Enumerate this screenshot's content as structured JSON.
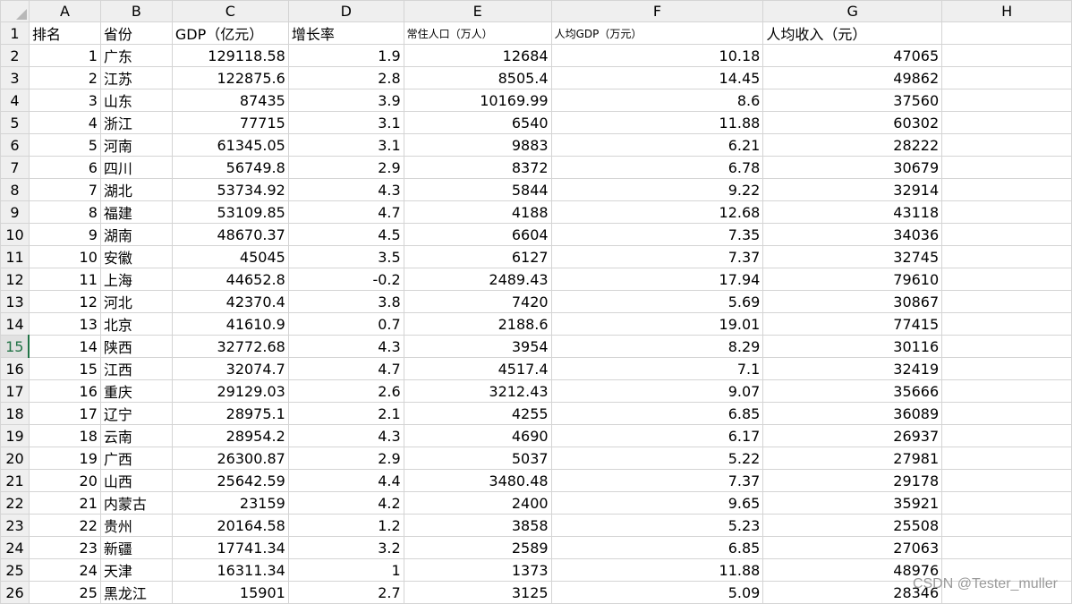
{
  "columns": [
    "A",
    "B",
    "C",
    "D",
    "E",
    "F",
    "G",
    "H"
  ],
  "headers": [
    "排名",
    "省份",
    "GDP（亿元）",
    "增长率",
    "常住人口（万人）",
    "人均GDP（万元）",
    "人均收入（元）",
    ""
  ],
  "rows": [
    [
      "1",
      "广东",
      "129118.58",
      "1.9",
      "12684",
      "10.18",
      "47065"
    ],
    [
      "2",
      "江苏",
      "122875.6",
      "2.8",
      "8505.4",
      "14.45",
      "49862"
    ],
    [
      "3",
      "山东",
      "87435",
      "3.9",
      "10169.99",
      "8.6",
      "37560"
    ],
    [
      "4",
      "浙江",
      "77715",
      "3.1",
      "6540",
      "11.88",
      "60302"
    ],
    [
      "5",
      "河南",
      "61345.05",
      "3.1",
      "9883",
      "6.21",
      "28222"
    ],
    [
      "6",
      "四川",
      "56749.8",
      "2.9",
      "8372",
      "6.78",
      "30679"
    ],
    [
      "7",
      "湖北",
      "53734.92",
      "4.3",
      "5844",
      "9.22",
      "32914"
    ],
    [
      "8",
      "福建",
      "53109.85",
      "4.7",
      "4188",
      "12.68",
      "43118"
    ],
    [
      "9",
      "湖南",
      "48670.37",
      "4.5",
      "6604",
      "7.35",
      "34036"
    ],
    [
      "10",
      "安徽",
      "45045",
      "3.5",
      "6127",
      "7.37",
      "32745"
    ],
    [
      "11",
      "上海",
      "44652.8",
      "-0.2",
      "2489.43",
      "17.94",
      "79610"
    ],
    [
      "12",
      "河北",
      "42370.4",
      "3.8",
      "7420",
      "5.69",
      "30867"
    ],
    [
      "13",
      "北京",
      "41610.9",
      "0.7",
      "2188.6",
      "19.01",
      "77415"
    ],
    [
      "14",
      "陕西",
      "32772.68",
      "4.3",
      "3954",
      "8.29",
      "30116"
    ],
    [
      "15",
      "江西",
      "32074.7",
      "4.7",
      "4517.4",
      "7.1",
      "32419"
    ],
    [
      "16",
      "重庆",
      "29129.03",
      "2.6",
      "3212.43",
      "9.07",
      "35666"
    ],
    [
      "17",
      "辽宁",
      "28975.1",
      "2.1",
      "4255",
      "6.85",
      "36089"
    ],
    [
      "18",
      "云南",
      "28954.2",
      "4.3",
      "4690",
      "6.17",
      "26937"
    ],
    [
      "19",
      "广西",
      "26300.87",
      "2.9",
      "5037",
      "5.22",
      "27981"
    ],
    [
      "20",
      "山西",
      "25642.59",
      "4.4",
      "3480.48",
      "7.37",
      "29178"
    ],
    [
      "21",
      "内蒙古",
      "23159",
      "4.2",
      "2400",
      "9.65",
      "35921"
    ],
    [
      "22",
      "贵州",
      "20164.58",
      "1.2",
      "3858",
      "5.23",
      "25508"
    ],
    [
      "23",
      "新疆",
      "17741.34",
      "3.2",
      "2589",
      "6.85",
      "27063"
    ],
    [
      "24",
      "天津",
      "16311.34",
      "1",
      "1373",
      "11.88",
      "48976"
    ],
    [
      "25",
      "黑龙江",
      "15901",
      "2.7",
      "3125",
      "5.09",
      "28346"
    ]
  ],
  "active_row": 15,
  "watermark": "CSDN @Tester_muller",
  "colors": {
    "grid": "#d4d4d4",
    "header_bg": "#efefef",
    "active": "#217346"
  }
}
